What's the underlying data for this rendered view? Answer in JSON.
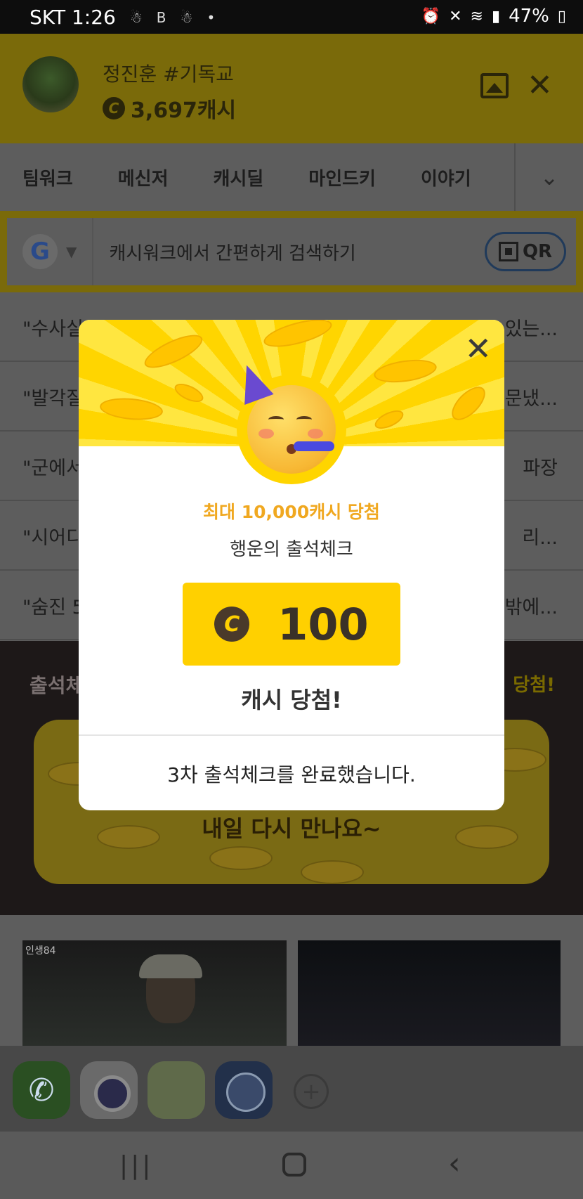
{
  "status_bar": {
    "carrier_time": "SKT 1:26",
    "left_icons": [
      "notification-icon",
      "b-icon",
      "notification-icon",
      "dot-icon"
    ],
    "right_icons": [
      "alarm-icon",
      "mute-icon",
      "wifi-icon",
      "signal-icon"
    ],
    "battery": "47%"
  },
  "header": {
    "user_name": "정진훈 #기독교",
    "cash_amount": "3,697캐시",
    "coin_symbol": "C"
  },
  "tabs": [
    "팀워크",
    "메신저",
    "캐시딜",
    "마인드키",
    "이야기"
  ],
  "search": {
    "google_letter": "G",
    "placeholder": "캐시워크에서 간편하게 검색하기",
    "qr_label": "QR"
  },
  "news": [
    {
      "left": "\"수사실",
      "right": "있는..."
    },
    {
      "left": "\"발각질",
      "right": "문냈..."
    },
    {
      "left": "\"군에서",
      "right": "파장"
    },
    {
      "left": "\"시어디",
      "right": "리..."
    },
    {
      "left": "\"숨진 5",
      "right": "밖에..."
    }
  ],
  "attendance": {
    "title": "출석체",
    "right_text": "당첨!",
    "card_text": "내일 다시 만나요~"
  },
  "thumbs": {
    "left_tag": "인생84"
  },
  "popup": {
    "subtitle": "최대 10,000캐시 당첨",
    "title": "행운의 출석체크",
    "coin_symbol": "C",
    "amount": "100",
    "prize_label": "캐시 당첨!",
    "footer": "3차 출석체크를 완료했습니다."
  },
  "colors": {
    "brand_yellow": "#ffd500",
    "accent_orange": "#f0a820"
  }
}
